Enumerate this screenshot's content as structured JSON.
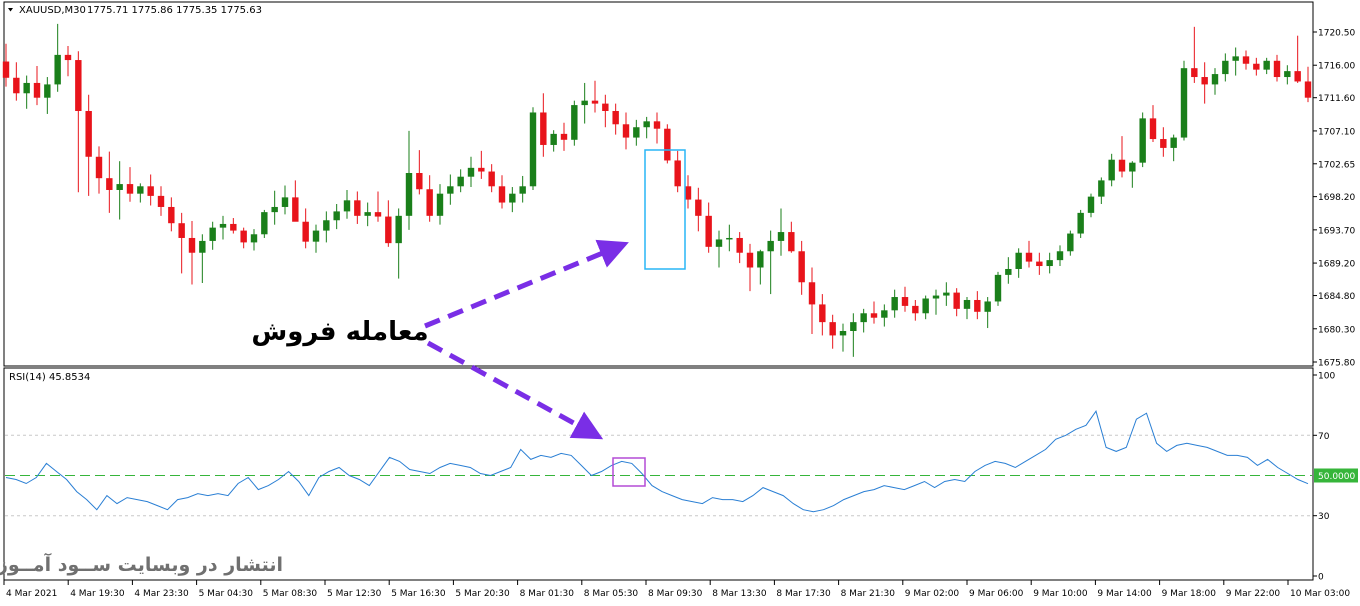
{
  "window": {
    "symbol_header": "XAUUSD,M30",
    "ohlc_text": "1775.71 1775.86 1775.35 1775.63"
  },
  "colors": {
    "bull": "#1a7f1a",
    "bear": "#e8141b",
    "rsi_line": "#2a7fd4",
    "level_line": "#36b53a",
    "level_badge": "#36b53a",
    "grid": "#c8c8c8",
    "highlight_price": "#29b6f6",
    "highlight_rsi": "#b44bd6",
    "arrow": "#7a2ee6"
  },
  "annotations": {
    "sell_trade_label": "معامله فروش",
    "watermark": "انتشار در وبسایت ســود آمــوز"
  },
  "chart_data": [
    {
      "type": "candlestick",
      "title": "XAUUSD,M30",
      "price_axis_ticks": [
        "1720.50",
        "1716.00",
        "1711.60",
        "1707.10",
        "1702.65",
        "1698.20",
        "1693.70",
        "1689.20",
        "1684.80",
        "1680.30",
        "1675.80"
      ],
      "ylim": [
        1675.8,
        1720.5
      ],
      "time_axis_ticks": [
        "4 Mar 2021",
        "4 Mar 19:30",
        "4 Mar 23:30",
        "5 Mar 04:30",
        "5 Mar 08:30",
        "5 Mar 12:30",
        "5 Mar 16:30",
        "5 Mar 20:30",
        "8 Mar 01:30",
        "8 Mar 05:30",
        "8 Mar 09:30",
        "8 Mar 13:30",
        "8 Mar 17:30",
        "8 Mar 21:30",
        "9 Mar 02:00",
        "9 Mar 06:00",
        "9 Mar 10:00",
        "9 Mar 14:00",
        "9 Mar 18:00",
        "9 Mar 22:00",
        "10 Mar 03:00"
      ],
      "candles": [
        [
          1716.5,
          1718.9,
          1713.1,
          1714.3
        ],
        [
          1714.3,
          1716.4,
          1711.2,
          1712.2
        ],
        [
          1712.2,
          1714.6,
          1710.1,
          1713.6
        ],
        [
          1713.6,
          1715.9,
          1710.6,
          1711.6
        ],
        [
          1711.6,
          1714.4,
          1709.4,
          1713.4
        ],
        [
          1713.4,
          1721.6,
          1712.4,
          1717.4
        ],
        [
          1717.4,
          1718.6,
          1714.5,
          1716.7
        ],
        [
          1716.7,
          1717.9,
          1698.8,
          1709.8
        ],
        [
          1709.8,
          1712.0,
          1698.3,
          1703.6
        ],
        [
          1703.6,
          1705.0,
          1698.6,
          1700.7
        ],
        [
          1700.7,
          1704.3,
          1696.0,
          1699.1
        ],
        [
          1699.1,
          1703.0,
          1695.1,
          1699.9
        ],
        [
          1699.9,
          1702.2,
          1697.5,
          1698.6
        ],
        [
          1698.6,
          1700.0,
          1697.4,
          1699.6
        ],
        [
          1699.6,
          1701.2,
          1697.0,
          1698.3
        ],
        [
          1698.3,
          1699.6,
          1695.6,
          1696.8
        ],
        [
          1696.8,
          1698.1,
          1693.5,
          1694.6
        ],
        [
          1694.6,
          1696.0,
          1687.8,
          1692.6
        ],
        [
          1692.6,
          1694.9,
          1686.3,
          1690.6
        ],
        [
          1690.6,
          1693.1,
          1686.5,
          1692.2
        ],
        [
          1692.2,
          1694.8,
          1691.0,
          1694.0
        ],
        [
          1694.0,
          1695.6,
          1692.4,
          1694.5
        ],
        [
          1694.5,
          1695.3,
          1693.2,
          1693.6
        ],
        [
          1693.6,
          1694.0,
          1691.2,
          1692.0
        ],
        [
          1692.0,
          1693.8,
          1690.9,
          1693.1
        ],
        [
          1693.1,
          1696.4,
          1692.6,
          1696.1
        ],
        [
          1696.1,
          1699.0,
          1694.4,
          1696.8
        ],
        [
          1696.8,
          1699.7,
          1695.8,
          1698.1
        ],
        [
          1698.1,
          1700.4,
          1695.2,
          1694.8
        ],
        [
          1694.8,
          1696.6,
          1691.2,
          1692.1
        ],
        [
          1692.1,
          1694.4,
          1690.6,
          1693.6
        ],
        [
          1693.6,
          1696.2,
          1692.0,
          1695.0
        ],
        [
          1695.0,
          1697.2,
          1693.8,
          1696.2
        ],
        [
          1696.2,
          1699.1,
          1695.2,
          1697.7
        ],
        [
          1697.7,
          1698.9,
          1694.5,
          1695.6
        ],
        [
          1695.6,
          1697.4,
          1694.2,
          1696.1
        ],
        [
          1696.1,
          1698.9,
          1694.8,
          1695.5
        ],
        [
          1695.5,
          1697.7,
          1691.4,
          1691.9
        ],
        [
          1691.9,
          1696.6,
          1687.1,
          1695.6
        ],
        [
          1695.6,
          1707.1,
          1693.7,
          1701.4
        ],
        [
          1701.4,
          1704.5,
          1698.5,
          1699.2
        ],
        [
          1699.2,
          1701.1,
          1694.8,
          1695.6
        ],
        [
          1695.6,
          1699.9,
          1694.4,
          1698.6
        ],
        [
          1698.6,
          1701.2,
          1697.1,
          1699.6
        ],
        [
          1699.6,
          1701.9,
          1698.8,
          1700.9
        ],
        [
          1700.9,
          1703.6,
          1699.5,
          1702.1
        ],
        [
          1702.1,
          1704.4,
          1700.6,
          1701.6
        ],
        [
          1701.6,
          1702.6,
          1698.8,
          1699.6
        ],
        [
          1699.6,
          1701.1,
          1696.6,
          1697.4
        ],
        [
          1697.4,
          1699.5,
          1696.1,
          1698.6
        ],
        [
          1698.6,
          1701.0,
          1697.4,
          1699.6
        ],
        [
          1699.6,
          1710.3,
          1699.1,
          1709.6
        ],
        [
          1709.6,
          1712.2,
          1703.6,
          1705.2
        ],
        [
          1705.2,
          1707.2,
          1704.3,
          1706.7
        ],
        [
          1706.7,
          1708.2,
          1704.4,
          1705.9
        ],
        [
          1705.9,
          1711.2,
          1705.1,
          1710.6
        ],
        [
          1710.6,
          1713.6,
          1708.1,
          1711.2
        ],
        [
          1711.2,
          1713.9,
          1709.6,
          1710.8
        ],
        [
          1710.8,
          1712.0,
          1707.6,
          1709.8
        ],
        [
          1709.8,
          1710.8,
          1706.6,
          1708.0
        ],
        [
          1708.0,
          1709.6,
          1704.6,
          1706.2
        ],
        [
          1706.2,
          1708.6,
          1705.1,
          1707.6
        ],
        [
          1707.6,
          1709.0,
          1706.1,
          1708.4
        ],
        [
          1708.4,
          1709.6,
          1705.4,
          1707.4
        ],
        [
          1707.4,
          1708.0,
          1702.7,
          1703.1
        ],
        [
          1703.1,
          1704.4,
          1698.8,
          1699.6
        ],
        [
          1699.6,
          1701.1,
          1696.6,
          1697.8
        ],
        [
          1697.8,
          1699.4,
          1693.5,
          1695.6
        ],
        [
          1695.6,
          1697.4,
          1690.6,
          1691.4
        ],
        [
          1691.4,
          1693.6,
          1688.6,
          1692.4
        ],
        [
          1692.4,
          1694.4,
          1690.8,
          1692.6
        ],
        [
          1692.6,
          1693.4,
          1689.2,
          1690.6
        ],
        [
          1690.6,
          1691.8,
          1685.4,
          1688.6
        ],
        [
          1688.6,
          1691.0,
          1686.3,
          1690.8
        ],
        [
          1690.8,
          1693.6,
          1685.0,
          1692.2
        ],
        [
          1692.2,
          1696.6,
          1690.2,
          1693.4
        ],
        [
          1693.4,
          1694.8,
          1690.6,
          1690.8
        ],
        [
          1690.8,
          1692.2,
          1684.9,
          1686.6
        ],
        [
          1686.6,
          1688.6,
          1679.6,
          1683.6
        ],
        [
          1683.6,
          1685.0,
          1679.4,
          1681.2
        ],
        [
          1681.2,
          1682.2,
          1677.6,
          1679.4
        ],
        [
          1679.4,
          1681.0,
          1677.2,
          1680.0
        ],
        [
          1680.0,
          1682.4,
          1676.5,
          1681.2
        ],
        [
          1681.2,
          1683.0,
          1679.8,
          1682.4
        ],
        [
          1682.4,
          1684.0,
          1681.0,
          1681.8
        ],
        [
          1681.8,
          1683.6,
          1680.6,
          1682.8
        ],
        [
          1682.8,
          1685.6,
          1681.8,
          1684.6
        ],
        [
          1684.6,
          1686.0,
          1682.6,
          1683.4
        ],
        [
          1683.4,
          1684.2,
          1681.4,
          1682.4
        ],
        [
          1682.4,
          1684.8,
          1681.6,
          1684.4
        ],
        [
          1684.4,
          1685.6,
          1682.2,
          1684.8
        ],
        [
          1684.8,
          1686.6,
          1683.4,
          1685.2
        ],
        [
          1685.2,
          1685.8,
          1682.0,
          1683.0
        ],
        [
          1683.0,
          1684.6,
          1681.6,
          1684.2
        ],
        [
          1684.2,
          1685.4,
          1681.6,
          1682.6
        ],
        [
          1682.6,
          1684.6,
          1680.4,
          1684.0
        ],
        [
          1684.0,
          1688.0,
          1683.4,
          1687.6
        ],
        [
          1687.6,
          1690.0,
          1686.4,
          1688.4
        ],
        [
          1688.4,
          1691.2,
          1687.2,
          1690.6
        ],
        [
          1690.6,
          1692.2,
          1688.6,
          1689.4
        ],
        [
          1689.4,
          1690.6,
          1687.6,
          1688.8
        ],
        [
          1688.8,
          1690.6,
          1687.8,
          1689.6
        ],
        [
          1689.6,
          1691.6,
          1688.8,
          1690.8
        ],
        [
          1690.8,
          1693.6,
          1690.2,
          1693.2
        ],
        [
          1693.2,
          1696.4,
          1692.6,
          1696.0
        ],
        [
          1696.0,
          1698.6,
          1695.4,
          1698.2
        ],
        [
          1698.2,
          1700.8,
          1697.2,
          1700.4
        ],
        [
          1700.4,
          1704.0,
          1699.6,
          1703.2
        ],
        [
          1703.2,
          1706.4,
          1700.8,
          1701.6
        ],
        [
          1701.6,
          1703.0,
          1699.4,
          1702.8
        ],
        [
          1702.8,
          1709.6,
          1702.2,
          1708.8
        ],
        [
          1708.8,
          1710.6,
          1705.6,
          1706.0
        ],
        [
          1706.0,
          1707.6,
          1703.6,
          1704.8
        ],
        [
          1704.8,
          1706.6,
          1703.0,
          1706.2
        ],
        [
          1706.2,
          1716.6,
          1705.8,
          1715.6
        ],
        [
          1715.6,
          1721.2,
          1713.6,
          1714.4
        ],
        [
          1714.4,
          1716.4,
          1710.8,
          1713.4
        ],
        [
          1713.4,
          1715.6,
          1712.0,
          1714.8
        ],
        [
          1714.8,
          1717.6,
          1713.8,
          1716.6
        ],
        [
          1716.6,
          1718.4,
          1714.6,
          1717.2
        ],
        [
          1717.2,
          1718.0,
          1715.4,
          1716.2
        ],
        [
          1716.2,
          1717.0,
          1714.6,
          1715.4
        ],
        [
          1715.4,
          1717.0,
          1714.8,
          1716.6
        ],
        [
          1716.6,
          1717.4,
          1713.8,
          1714.4
        ],
        [
          1714.4,
          1716.0,
          1713.4,
          1715.2
        ],
        [
          1715.2,
          1720.0,
          1713.6,
          1713.8
        ],
        [
          1713.8,
          1715.8,
          1711.0,
          1711.6
        ]
      ]
    },
    {
      "type": "line",
      "title": "RSI(14) 45.8534",
      "ylim": [
        0,
        100
      ],
      "y_axis_ticks": [
        "100",
        "70",
        "30",
        "0"
      ],
      "level_badge": "50.0000",
      "levels": [
        70,
        50,
        30
      ],
      "values": [
        49,
        48,
        46,
        49,
        56,
        52,
        48,
        42,
        38,
        33,
        40,
        36,
        39,
        38,
        37,
        35,
        33,
        38,
        39,
        41,
        40,
        41,
        40,
        46,
        49,
        43,
        45,
        48,
        52,
        47,
        40,
        49,
        52,
        54,
        50,
        48,
        45,
        52,
        59,
        57,
        53,
        52,
        51,
        54,
        56,
        55,
        54,
        51,
        50,
        52,
        54,
        63,
        58,
        60,
        59,
        61,
        60,
        55,
        50,
        52,
        55,
        57,
        56,
        51,
        45,
        42,
        40,
        38,
        37,
        36,
        39,
        38,
        38,
        37,
        40,
        44,
        42,
        40,
        36,
        33,
        32,
        33,
        35,
        38,
        40,
        42,
        43,
        45,
        44,
        43,
        45,
        47,
        44,
        47,
        48,
        47,
        52,
        55,
        57,
        56,
        54,
        57,
        60,
        63,
        68,
        70,
        73,
        75,
        82,
        64,
        62,
        64,
        78,
        81,
        66,
        62,
        65,
        66,
        65,
        64,
        62,
        60,
        60,
        59,
        55,
        58,
        54,
        51,
        48,
        45.9
      ]
    }
  ]
}
